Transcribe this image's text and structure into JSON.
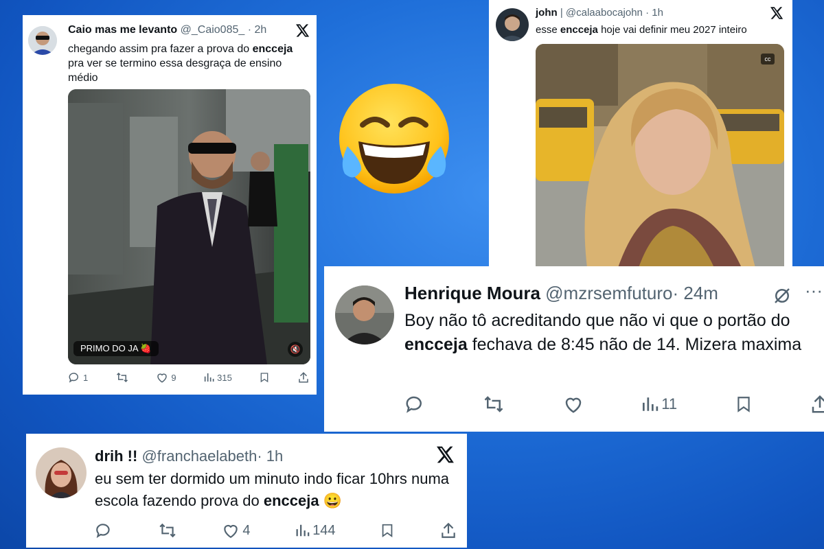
{
  "emoji": "😂",
  "tweets": [
    {
      "name": "Caio mas me levanto",
      "handle": "@_Caio085_",
      "time": "· 2h",
      "text_pre": "chegando assim pra fazer a prova do ",
      "text_bold": "encceja",
      "text_post": " pra ver se termino essa desgraça de ensino médio",
      "video_caption": "PRIMO DO JA 🍓",
      "replies": "1",
      "retweets": "",
      "likes": "9",
      "views": "315"
    },
    {
      "name": "john",
      "handle": "@calaabocajohn",
      "time": "· 1h",
      "text_pre": "esse ",
      "text_bold": "encceja",
      "text_post": " hoje vai definir meu 2027 inteiro"
    },
    {
      "name": "Henrique Moura",
      "handle": "@mzrsemfuturo",
      "time": "· 24m",
      "text_pre": "Boy não tô acreditando que não vi que o portão do ",
      "text_bold": "encceja",
      "text_post": " fechava de 8:45 não de 14. Mizera maxima",
      "views": "11"
    },
    {
      "name": "drih !!",
      "handle": "@franchaelabeth",
      "time": "· 1h",
      "text_pre": "eu sem ter dormido um minuto indo ficar 10hrs numa escola fazendo prova do ",
      "text_bold": "encceja",
      "text_post": " 😀",
      "likes": "4",
      "views": "144"
    }
  ],
  "colors": {
    "background": "#1f6fd9",
    "text": "#0f1419",
    "muted": "#536471"
  }
}
